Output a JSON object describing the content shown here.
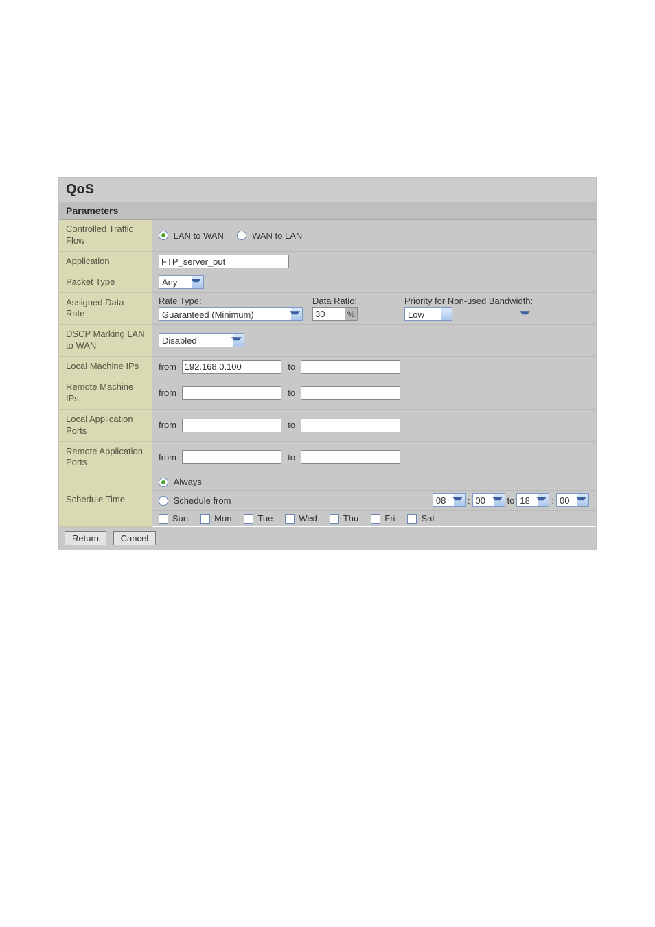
{
  "title": "QoS",
  "section": "Parameters",
  "labels": {
    "traffic_flow": "Controlled Traffic Flow",
    "application": "Application",
    "packet_type": "Packet Type",
    "assigned_rate": "Assigned Data Rate",
    "dscp": "DSCP Marking LAN to WAN",
    "local_ips": "Local Machine IPs",
    "remote_ips": "Remote Machine IPs",
    "local_ports": "Local Application Ports",
    "remote_ports": "Remote Application Ports",
    "schedule": "Schedule Time"
  },
  "traffic_flow": {
    "opt1": "LAN to WAN",
    "opt2": "WAN to LAN"
  },
  "application_value": "FTP_server_out",
  "packet_type_value": "Any",
  "rate": {
    "rate_type_label": "Rate Type:",
    "rate_type_value": "Guaranteed (Minimum)",
    "data_ratio_label": "Data Ratio:",
    "data_ratio_value": "30",
    "percent": "%",
    "priority_label": "Priority for Non-used Bandwidth:",
    "priority_value": "Low"
  },
  "dscp_value": "Disabled",
  "from_label": "from",
  "to_label": "to",
  "local_ip_from": "192.168.0.100",
  "local_ip_to": "",
  "remote_ip_from": "",
  "remote_ip_to": "",
  "local_port_from": "",
  "local_port_to": "",
  "remote_port_from": "",
  "remote_port_to": "",
  "schedule": {
    "always": "Always",
    "schedule_from": "Schedule from",
    "to": "to",
    "hh1": "08",
    "mm1": "00",
    "hh2": "18",
    "mm2": "00",
    "colon": ":",
    "days": {
      "sun": "Sun",
      "mon": "Mon",
      "tue": "Tue",
      "wed": "Wed",
      "thu": "Thu",
      "fri": "Fri",
      "sat": "Sat"
    }
  },
  "buttons": {
    "return": "Return",
    "cancel": "Cancel"
  }
}
